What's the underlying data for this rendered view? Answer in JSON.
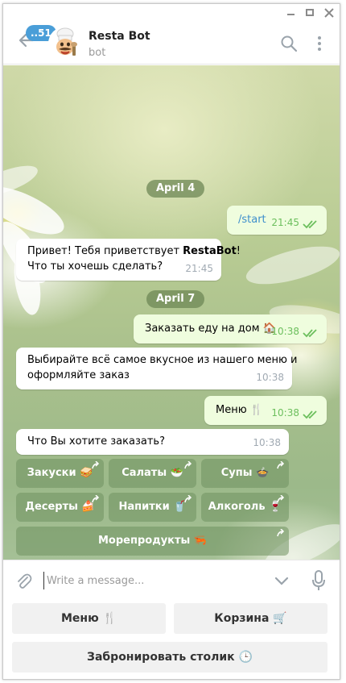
{
  "header": {
    "unread_count": "51",
    "chat_name": "Resta Bot",
    "chat_status": "bot"
  },
  "messages": {
    "date1": "April 4",
    "start_cmd": "/start",
    "start_time": "21:45",
    "greet_line1_pre": "Привет! Тебя приветствует ",
    "greet_line1_bold": "RestaBot",
    "greet_line1_post": "!",
    "greet_line2": "Что ты хочешь сделать?",
    "greet_time": "21:45",
    "date2": "April 7",
    "order_text": "Заказать еду на дом",
    "order_emoji": "🏠",
    "order_time": "10:38",
    "menu_info_line1": "Выбирайте всё самое вкусное из нашего меню и",
    "menu_info_line2": "оформляйте заказ",
    "menu_info_time": "10:38",
    "menu_text": "Меню",
    "menu_emoji": "🍴",
    "menu_time": "10:38",
    "question_text": "Что Вы хотите заказать?",
    "question_time": "10:38"
  },
  "inline_keyboard": [
    {
      "label": "Закуски",
      "emoji": "🥪"
    },
    {
      "label": "Салаты",
      "emoji": "🥗"
    },
    {
      "label": "Супы",
      "emoji": "🍲"
    },
    {
      "label": "Десерты",
      "emoji": "🍰"
    },
    {
      "label": "Напитки",
      "emoji": "🥤"
    },
    {
      "label": "Алкоголь",
      "emoji": "🍷"
    },
    {
      "label": "Морепродукты",
      "emoji": "🦐"
    }
  ],
  "composer": {
    "placeholder": "Write a message..."
  },
  "reply_keyboard": {
    "menu_label": "Меню",
    "menu_emoji": "🍴",
    "cart_label": "Корзина",
    "cart_emoji": "🛒",
    "book_label": "Забронировать столик",
    "book_emoji": "🕒"
  },
  "colors": {
    "accent": "#4a9ed8",
    "outgoing_bubble": "#effdde",
    "check_green": "#6cbf5d"
  }
}
